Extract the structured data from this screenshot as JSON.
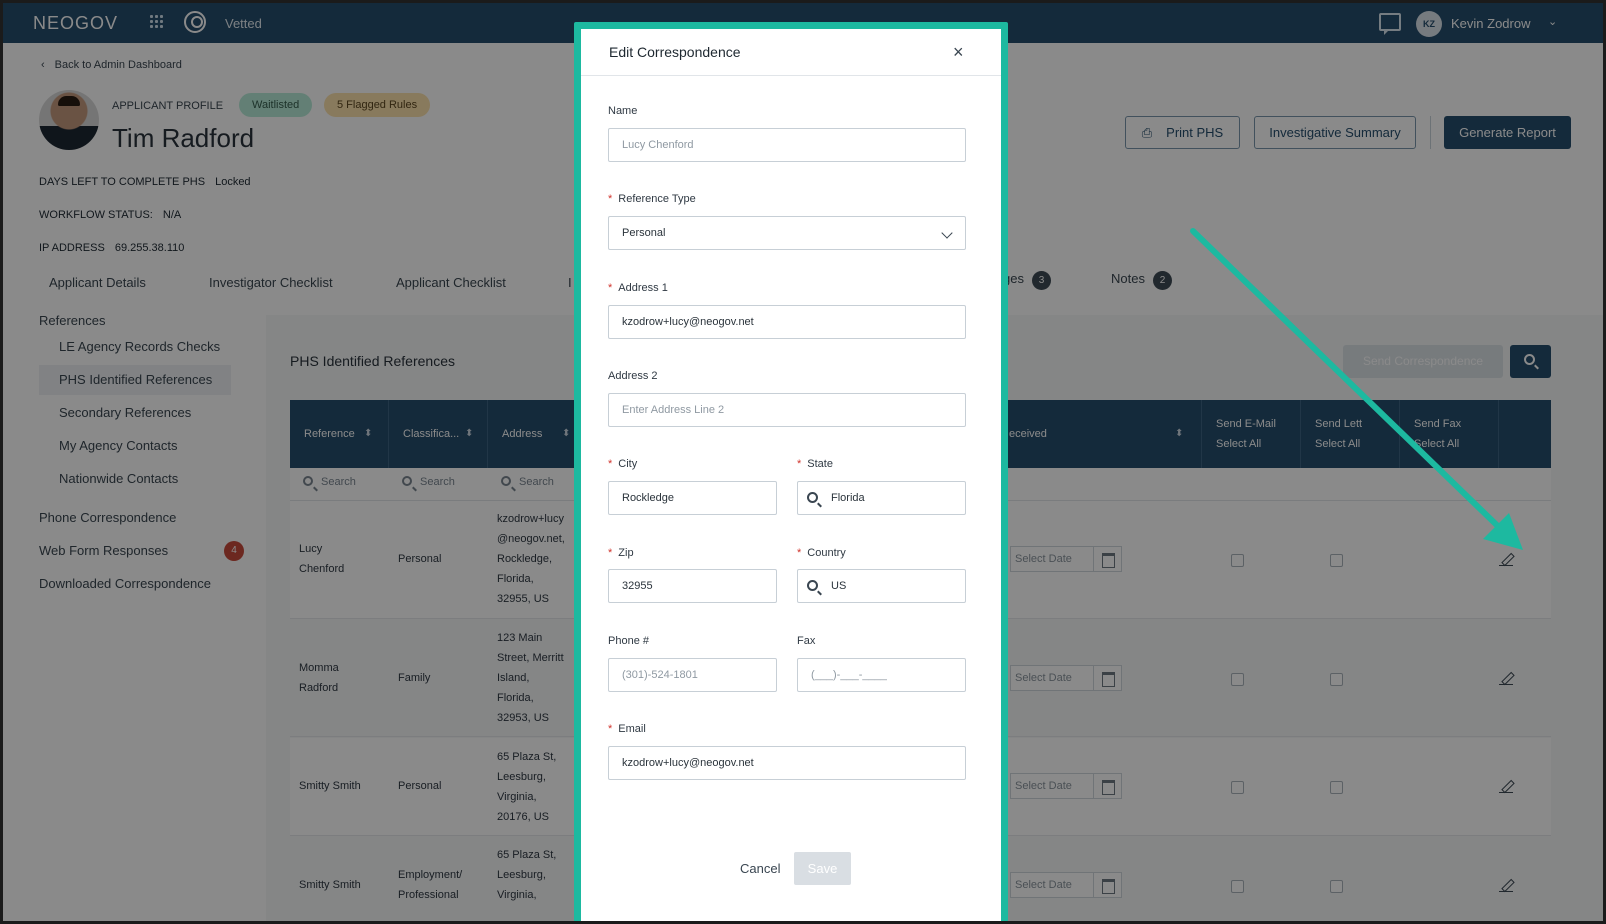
{
  "app": {
    "logo": "NEOGOV",
    "product": "Vetted",
    "user_initials": "KZ",
    "user_name": "Kevin Zodrow"
  },
  "page": {
    "back_link": "Back to Admin Dashboard",
    "profile_label": "APPLICANT PROFILE",
    "status_pill": "Waitlisted",
    "flagged_pill": "5 Flagged Rules",
    "applicant_name": "Tim Radford",
    "meta": [
      {
        "label": "DAYS LEFT TO COMPLETE PHS",
        "value": "Locked"
      },
      {
        "label": "WORKFLOW STATUS:",
        "value": "N/A"
      },
      {
        "label": "IP ADDRESS",
        "value": "69.255.38.110"
      }
    ],
    "buttons": {
      "print": "Print PHS",
      "investigative": "Investigative Summary",
      "generate": "Generate Report"
    }
  },
  "tabs": [
    {
      "label": "Applicant Details"
    },
    {
      "label": "Investigator Checklist"
    },
    {
      "label": "Applicant Checklist"
    },
    {
      "label": "I"
    },
    {
      "label": "ges",
      "count": "3"
    },
    {
      "label": "Notes",
      "count": "2"
    }
  ],
  "sidebar": {
    "section": "References",
    "items": [
      "LE Agency Records Checks",
      "PHS Identified References",
      "Secondary References",
      "My Agency Contacts",
      "Nationwide Contacts"
    ],
    "phone": "Phone Correspondence",
    "webform": "Web Form Responses",
    "webform_count": "4",
    "downloaded": "Downloaded Correspondence"
  },
  "table": {
    "title": "PHS Identified References",
    "send_button": "Send Correspondence",
    "headers": {
      "reference": "Reference",
      "classification": "Classifica...",
      "address": "Address",
      "received": "eceived",
      "email": "Send E-Mail",
      "letter": "Send Lett",
      "fax": "Send Fax",
      "select_all": "Select All"
    },
    "search_placeholder": "Search",
    "date_placeholder": "Select Date",
    "rows": [
      {
        "ref1": "Lucy",
        "ref2": "Chenford",
        "class1": "Personal",
        "class2": "",
        "addr": [
          "kzodrow+lucy",
          "@neogov.net,",
          "Rockledge,",
          "Florida,",
          "32955, US"
        ]
      },
      {
        "ref1": "Momma",
        "ref2": "Radford",
        "class1": "Family",
        "class2": "",
        "addr": [
          "123 Main",
          "Street, Merritt",
          "Island,",
          "Florida,",
          "32953, US"
        ]
      },
      {
        "ref1": "Smitty Smith",
        "ref2": "",
        "class1": "Personal",
        "class2": "",
        "addr": [
          "65 Plaza St,",
          "Leesburg,",
          "Virginia,",
          "20176, US",
          ""
        ]
      },
      {
        "ref1": "Smitty Smith",
        "ref2": "",
        "class1": "Employment/",
        "class2": "Professional",
        "addr": [
          "65 Plaza St,",
          "Leesburg,",
          "Virginia,",
          "",
          ""
        ]
      }
    ]
  },
  "modal": {
    "title": "Edit Correspondence",
    "close": "×",
    "name_label": "Name",
    "name_value": "Lucy Chenford",
    "ref_type_label": "Reference Type",
    "ref_type_value": "Personal",
    "address1_label": "Address 1",
    "address1_value": "kzodrow+lucy@neogov.net",
    "address2_label": "Address 2",
    "address2_placeholder": "Enter Address Line 2",
    "city_label": "City",
    "city_value": "Rockledge",
    "state_label": "State",
    "state_value": "Florida",
    "zip_label": "Zip",
    "zip_value": "32955",
    "country_label": "Country",
    "country_value": "US",
    "phone_label": "Phone #",
    "phone_value": "(301)-524-1801",
    "fax_label": "Fax",
    "fax_placeholder": "(___)-___-____",
    "email_label": "Email",
    "email_value": "kzodrow+lucy@neogov.net",
    "cancel": "Cancel",
    "save": "Save"
  },
  "colors": {
    "brand": "#264e6d",
    "highlight": "#1db9a0",
    "required": "#d0342c"
  },
  "icons": [
    "grid-icon",
    "vetted-icon",
    "chat-icon",
    "chevron-down-icon",
    "back-chevron-icon",
    "printer-icon",
    "search-icon",
    "calendar-icon",
    "edit-icon",
    "close-icon"
  ]
}
